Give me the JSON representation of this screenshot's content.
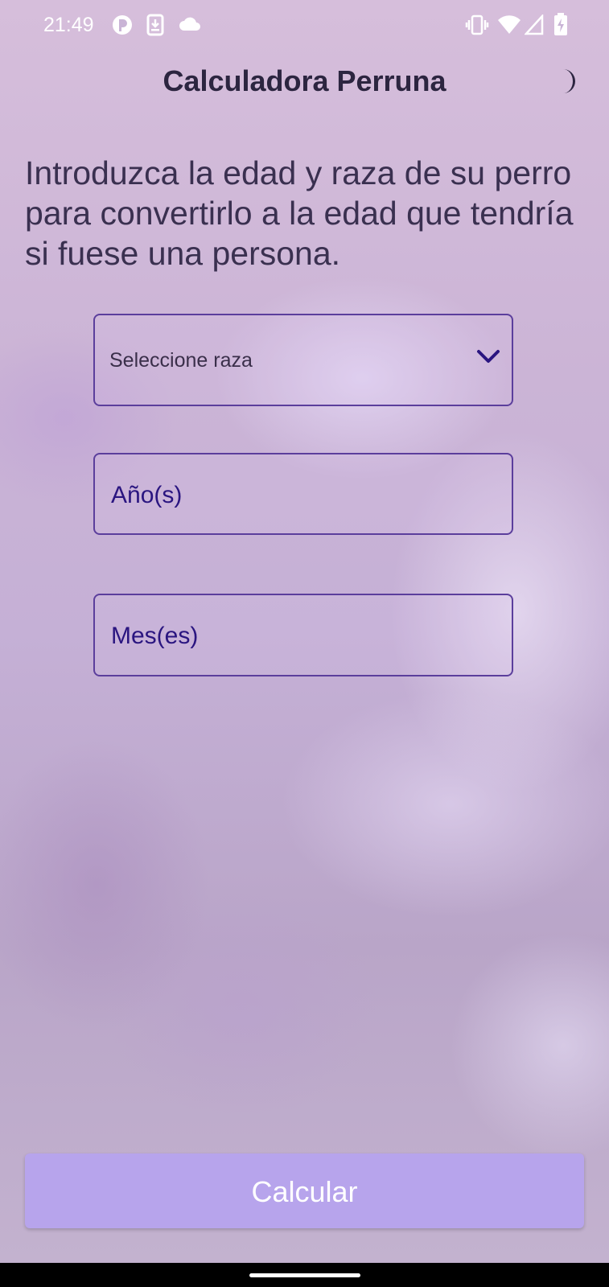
{
  "status_bar": {
    "time": "21:49",
    "left_icons": [
      "app-notification-icon",
      "download-icon",
      "cloud-icon"
    ],
    "right_icons": [
      "vibrate-icon",
      "wifi-icon",
      "signal-icon",
      "battery-charging-icon"
    ]
  },
  "header": {
    "title": "Calculadora Perruna",
    "theme_toggle_icon": "moon-icon"
  },
  "main": {
    "intro_text": "Introduzca la edad y raza de su perro para convertirlo a la edad que tendría si fuese una persona.",
    "breed_select": {
      "placeholder": "Seleccione raza",
      "icon": "chevron-down-icon"
    },
    "years_input": {
      "placeholder": "Año(s)",
      "value": ""
    },
    "months_input": {
      "placeholder": "Mes(es)",
      "value": ""
    },
    "calculate_button": "Calcular"
  },
  "colors": {
    "accent": "#5b3e9c",
    "button_bg": "#b7a4ec",
    "title_text": "#2c2540",
    "input_text": "#2a1580"
  }
}
